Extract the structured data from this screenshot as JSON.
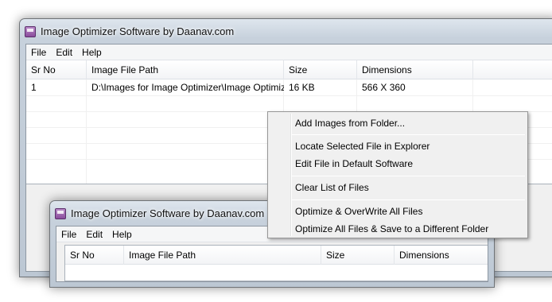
{
  "main_window": {
    "title": "Image Optimizer Software by Daanav.com",
    "menu": [
      "File",
      "Edit",
      "Help"
    ],
    "columns": [
      "Sr No",
      "Image File Path",
      "Size",
      "Dimensions"
    ],
    "rows": [
      {
        "sr": "1",
        "path": "D:\\Images for Image Optimizer\\Image Optimiz...",
        "size": "16 KB",
        "dimensions": "566 X 360"
      }
    ]
  },
  "context_menu": {
    "items": [
      "Add Images from Folder...",
      "Locate Selected File in Explorer",
      "Edit File in Default Software",
      "Clear List of Files",
      "Optimize & OverWrite All Files",
      "Optimize All Files & Save to a Different Folder"
    ]
  },
  "back_window": {
    "title": "Image Optimizer Software by Daanav.com",
    "menu": [
      "File",
      "Edit",
      "Help"
    ],
    "columns": [
      "Sr No",
      "Image File Path",
      "Size",
      "Dimensions"
    ]
  },
  "icons": {
    "app": "floppy-disk-icon"
  }
}
